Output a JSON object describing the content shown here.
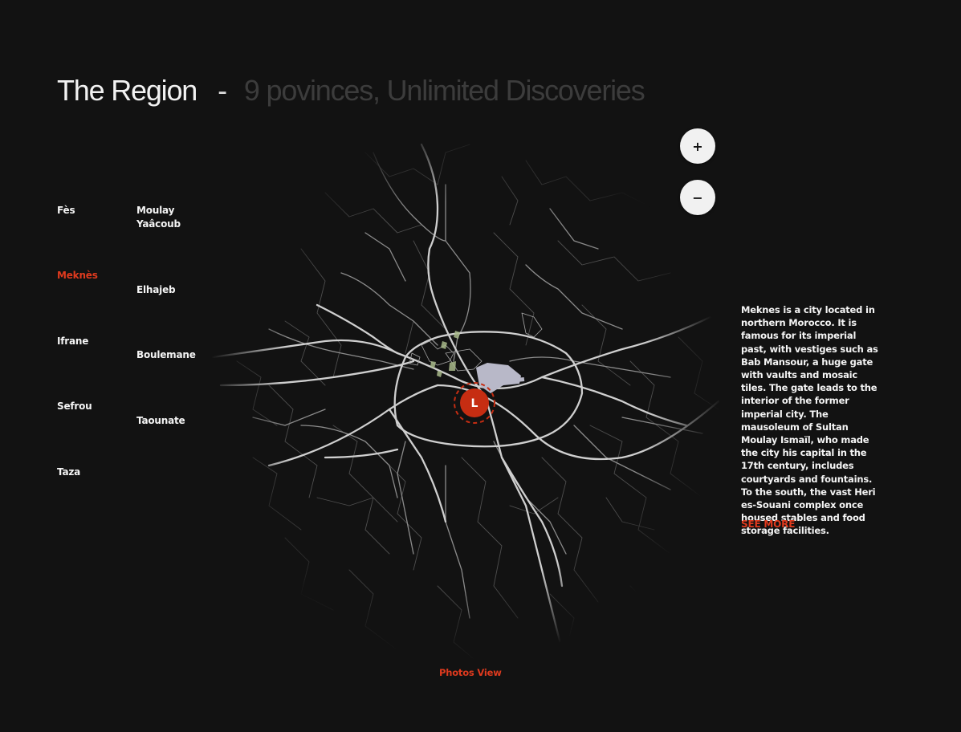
{
  "header": {
    "title": "The Region",
    "separator": "-",
    "subtitle": "9 povinces, Unlimited Discoveries"
  },
  "provinces": [
    {
      "label": "Fès"
    },
    {
      "label": "Moulay Yaâcoub"
    },
    {
      "label": "Meknès",
      "active": true
    },
    {
      "label": "Elhajeb"
    },
    {
      "label": "Ifrane"
    },
    {
      "label": "Boulemane"
    },
    {
      "label": "Sefrou"
    },
    {
      "label": "Taounate"
    },
    {
      "label": "Taza"
    }
  ],
  "map": {
    "marker_label": "L",
    "zoom_in_label": "+",
    "zoom_out_label": "−",
    "marker_color": "#c62d12"
  },
  "info": {
    "description": "Meknes is a city located in northern Morocco. It is famous for its imperial past, with vestiges such as Bab Mansour, a huge gate with vaults and mosaic tiles. The gate leads to the interior of the former imperial city. The mausoleum of Sultan Moulay Ismaïl, who made the city his capital in the 17th century, includes courtyards and fountains. To the south, the vast Heri es-Souani complex once housed stables and food storage facilities.",
    "see_more": "SEE MORE"
  },
  "footer": {
    "photos_view": "Photos View"
  },
  "colors": {
    "background": "#121212",
    "accent": "#e03a1e"
  }
}
